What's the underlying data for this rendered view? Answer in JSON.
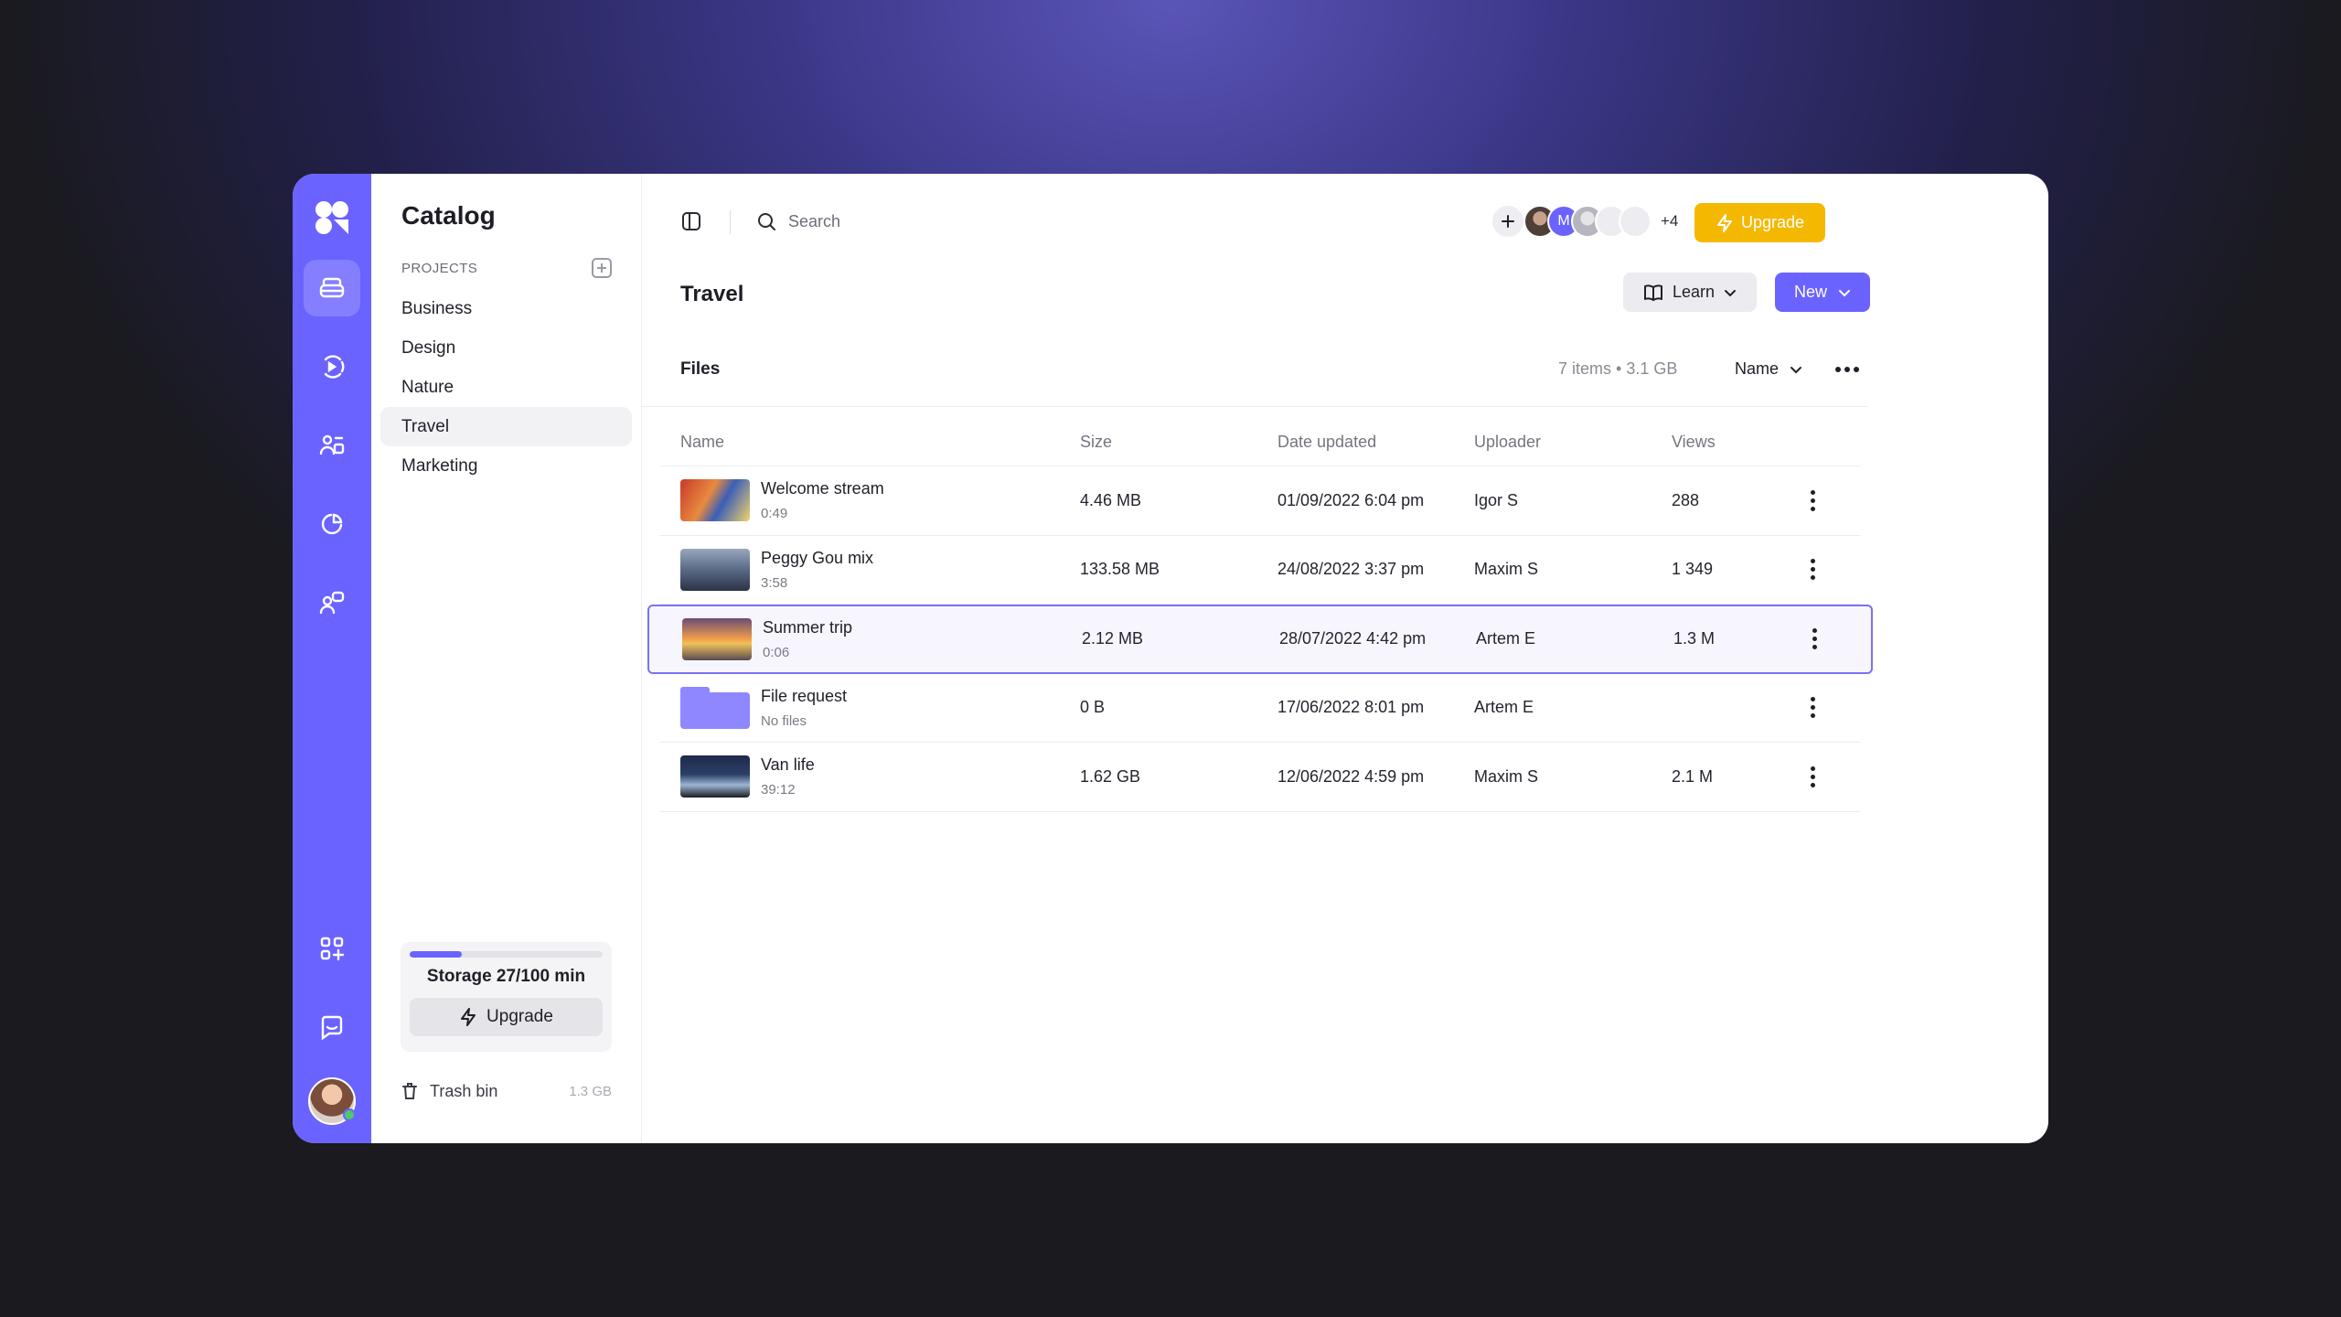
{
  "sidebar": {
    "title": "Catalog",
    "projects_heading": "PROJECTS",
    "projects": [
      {
        "label": "Business"
      },
      {
        "label": "Design"
      },
      {
        "label": "Nature"
      },
      {
        "label": "Travel",
        "active": true
      },
      {
        "label": "Marketing"
      }
    ],
    "storage": {
      "label": "Storage 27/100 min",
      "used": 27,
      "total": 100,
      "upgrade_label": "Upgrade"
    },
    "trash": {
      "label": "Trash bin",
      "size": "1.3 GB"
    }
  },
  "topbar": {
    "search_placeholder": "Search",
    "collaborators": [
      "",
      "M",
      "",
      "",
      ""
    ],
    "extra_count": "+4",
    "upgrade_label": "Upgrade"
  },
  "page": {
    "title": "Travel",
    "learn_label": "Learn",
    "new_label": "New",
    "section_label": "Files",
    "meta": "7 items • 3.1 GB",
    "sort_label": "Name"
  },
  "table": {
    "headers": {
      "name": "Name",
      "size": "Size",
      "date": "Date updated",
      "uploader": "Uploader",
      "views": "Views"
    },
    "rows": [
      {
        "name": "Welcome stream",
        "sub": "0:49",
        "size": "4.46 MB",
        "date": "01/09/2022 6:04 pm",
        "uploader": "Igor S",
        "views": "288"
      },
      {
        "name": "Peggy Gou mix",
        "sub": "3:58",
        "size": "133.58 MB",
        "date": "24/08/2022 3:37 pm",
        "uploader": "Maxim S",
        "views": "1 349"
      },
      {
        "name": "Summer trip",
        "sub": "0:06",
        "size": "2.12 MB",
        "date": "28/07/2022 4:42 pm",
        "uploader": "Artem E",
        "views": "1.3 M",
        "selected": true
      },
      {
        "name": "File request",
        "sub": "No files",
        "size": "0 B",
        "date": "17/06/2022 8:01 pm",
        "uploader": "Artem E",
        "views": ""
      },
      {
        "name": "Van life",
        "sub": "39:12",
        "size": "1.62 GB",
        "date": "12/06/2022 4:59 pm",
        "uploader": "Maxim S",
        "views": "2.1 M"
      }
    ]
  },
  "colors": {
    "accent": "#6b63ff",
    "upgrade": "#f5b800"
  }
}
